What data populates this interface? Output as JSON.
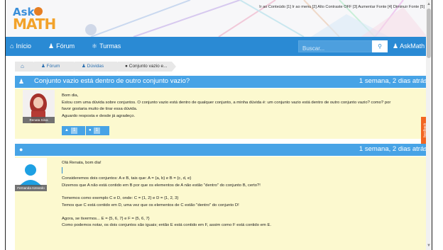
{
  "header": {
    "logo_top": "Ask",
    "logo_bottom": "MATH",
    "accessibility_links": "Ir ao Conteúdo [1] Ir ao menu [2] Alto Contraste OFF [3] Aumentar Fonte [4] Diminuir Fonte [5]"
  },
  "navbar": {
    "home_icon": "home-icon",
    "home_label": "Início",
    "forum_icon": "users-icon",
    "forum_label": "Fórum",
    "classes_icon": "group-icon",
    "classes_label": "Turmas",
    "search_placeholder": "Buscar...",
    "search_icon": "search-icon",
    "user_icon": "user-icon",
    "user_label": "AskMath"
  },
  "breadcrumb": {
    "items": [
      {
        "label": "",
        "icon": "home-icon"
      },
      {
        "label": "Fórum",
        "icon": "users-icon"
      },
      {
        "label": "Dúvidas",
        "icon": "users-icon"
      },
      {
        "label": "Conjunto vazio e...",
        "icon": "comment-icon"
      }
    ]
  },
  "topic": {
    "icon": "users-icon",
    "title": "Conjunto vazio está dentro de outro conjunto vazio?",
    "time": "1 semana, 2 dias atrás"
  },
  "post1": {
    "author": "Renata Silva",
    "lines": [
      "Bom dia,",
      "Estou com uma dúvida sobre conjuntos. O conjunto vazio está dentro de qualquer conjunto, a minha dúvida é: um conjunto vazio está dentro de outro conjunto vazio? como? por",
      "favor gostaria muito de tirar essa dúvida.",
      "Aguardo resposta e desde já agradeço."
    ],
    "like_count": "1",
    "reply_count": "1"
  },
  "reply": {
    "icon": "comment-icon",
    "time": "1 semana, 2 dias atrás",
    "author": "Fernanda Azevedo",
    "paragraphs": [
      [
        "Olá Renata, bom dia!"
      ],
      [
        "Consideremos dois conjuntos: A e B, tais que: A = {a, b} e B = {c, d, e}",
        "Dizemos que A não está contido em B por que os elementos de A não estão \"dentro\" do conjunto B, certo?!"
      ],
      [
        "Tomemos como exemplo C e D, onde: C = {1, 2} e D = {1, 2, 3}",
        "Temos que C está contido em D, uma vez que os elementos de C estão \"dentro\" do conjunto D!"
      ],
      [
        "Agora, se tivermos... E = {5, 6, 7} e F = {5, 6, 7}",
        "Como podemos notar, os dois conjuntos são iguais; então E está contido em F, assim como F está contido em E."
      ]
    ]
  },
  "feedback_label": "feedback",
  "colors": {
    "navbar": "#2a8ad4",
    "bar": "#47a3e6",
    "post_bg": "#fcf9cf",
    "feedback": "#f26522"
  }
}
